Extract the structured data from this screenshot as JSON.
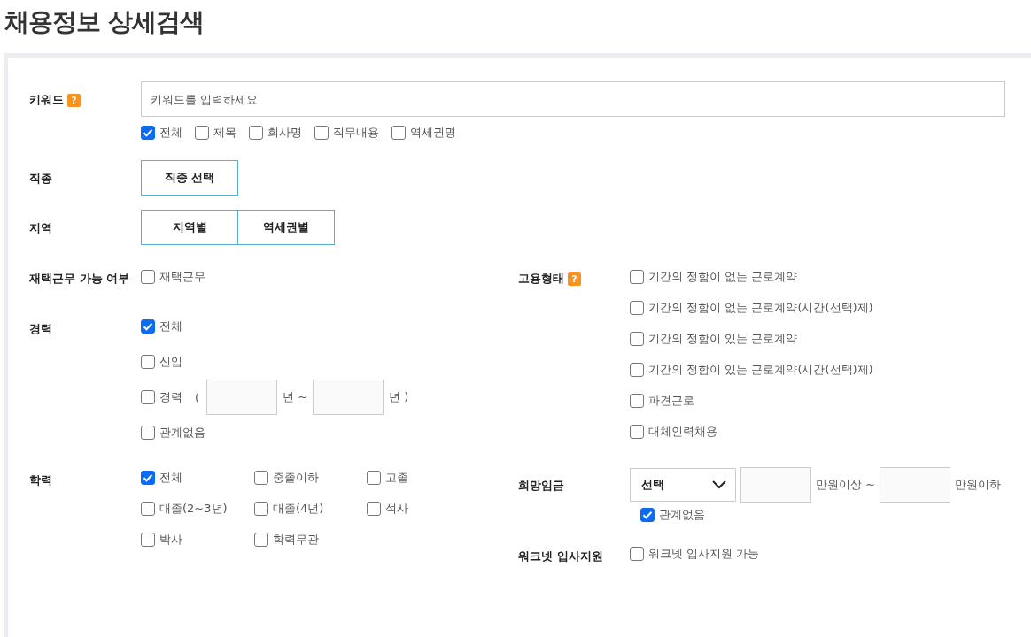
{
  "title": "채용정보 상세검색",
  "keyword": {
    "label": "키워드",
    "help": "?",
    "placeholder": "키워드를 입력하세요",
    "scopes": [
      {
        "label": "전체",
        "checked": true
      },
      {
        "label": "제목",
        "checked": false
      },
      {
        "label": "회사명",
        "checked": false
      },
      {
        "label": "직무내용",
        "checked": false
      },
      {
        "label": "역세권명",
        "checked": false
      }
    ]
  },
  "job_type": {
    "label": "직종",
    "buttons": [
      "직종 선택"
    ]
  },
  "region": {
    "label": "지역",
    "buttons": [
      "지역별",
      "역세권별"
    ]
  },
  "remote": {
    "label": "재택근무 가능 여부",
    "options": [
      {
        "label": "재택근무",
        "checked": false
      }
    ]
  },
  "career": {
    "label": "경력",
    "options": [
      {
        "kind": "check",
        "label": "전체",
        "checked": true
      },
      {
        "kind": "check",
        "label": "신입",
        "checked": false
      },
      {
        "kind": "range",
        "label": "경력",
        "checked": false,
        "open": "(",
        "unit_from": "년 ~",
        "unit_to": "년 )"
      },
      {
        "kind": "check",
        "label": "관계없음",
        "checked": false
      }
    ]
  },
  "education": {
    "label": "학력",
    "options": [
      {
        "label": "전체",
        "checked": true
      },
      {
        "label": "중졸이하",
        "checked": false
      },
      {
        "label": "고졸",
        "checked": false
      },
      {
        "label": "대졸(2~3년)",
        "checked": false
      },
      {
        "label": "대졸(4년)",
        "checked": false
      },
      {
        "label": "석사",
        "checked": false
      },
      {
        "label": "박사",
        "checked": false
      },
      {
        "label": "학력무관",
        "checked": false
      }
    ]
  },
  "employment": {
    "label": "고용형태",
    "help": "?",
    "options": [
      {
        "label": "기간의 정함이 없는 근로계약",
        "checked": false
      },
      {
        "label": "기간의 정함이 없는 근로계약(시간(선택)제)",
        "checked": false
      },
      {
        "label": "기간의 정함이 있는 근로계약",
        "checked": false
      },
      {
        "label": "기간의 정함이 있는 근로계약(시간(선택)제)",
        "checked": false
      },
      {
        "label": "파견근로",
        "checked": false
      },
      {
        "label": "대체인력채용",
        "checked": false
      }
    ]
  },
  "salary": {
    "label": "희망임금",
    "select": "선택",
    "unit_from": "만원이상 ~",
    "unit_to": "만원이하",
    "any": {
      "label": "관계없음",
      "checked": true
    }
  },
  "worknet": {
    "label": "워크넷 입사지원",
    "options": [
      {
        "label": "워크넷 입사지원 가능",
        "checked": false
      }
    ]
  }
}
